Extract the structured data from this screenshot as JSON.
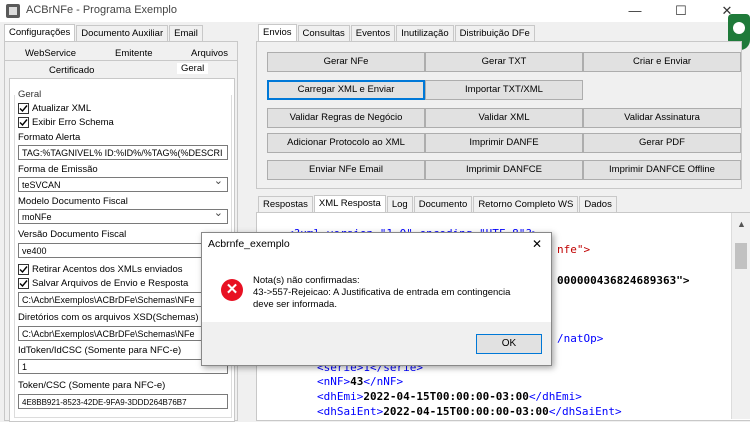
{
  "window": {
    "title": "ACBrNFe - Programa Exemplo",
    "minimize": "—",
    "maximize": "☐",
    "close": "✕"
  },
  "left": {
    "tabs": [
      "Configurações",
      "Documento Auxiliar",
      "Email"
    ],
    "subtabs_row1": [
      "WebService",
      "Emitente",
      "Arquivos"
    ],
    "subtabs_row2": [
      "Certificado",
      "Geral"
    ],
    "group_label": "Geral",
    "check_atualizar": "Atualizar XML",
    "check_exibir": "Exibir Erro Schema",
    "formato_alerta_label": "Formato Alerta",
    "formato_alerta_value": "TAG:%TAGNIVEL% ID:%ID%/%TAG%(%DESCRI",
    "forma_emissao_label": "Forma de Emissão",
    "forma_emissao_value": "teSVCAN",
    "modelo_label": "Modelo Documento Fiscal",
    "modelo_value": "moNFe",
    "versao_label": "Versão Documento Fiscal",
    "versao_value": "ve400",
    "check_retirar": "Retirar Acentos dos XMLs enviados",
    "check_salvar": "Salvar Arquivos de Envio e Resposta",
    "path1": "C:\\Acbr\\Exemplos\\ACBrDFe\\Schemas\\NFe",
    "xsd_label": "Diretórios com os arquivos XSD(Schemas)",
    "path2": "C:\\Acbr\\Exemplos\\ACBrDFe\\Schemas\\NFe",
    "idtoken_label": "IdToken/IdCSC (Somente para NFC-e)",
    "idtoken_value": "1",
    "token_label": "Token/CSC (Somente para NFC-e)",
    "token_value": "4E8BB921-8523-42DE-9FA9-3DDD264B76B7"
  },
  "right": {
    "tabs": [
      "Envios",
      "Consultas",
      "Eventos",
      "Inutilização",
      "Distribuição DFe"
    ],
    "buttons": [
      [
        "Gerar NFe",
        "Gerar TXT",
        "Criar e Enviar"
      ],
      [
        "Carregar XML e Enviar",
        "Importar TXT/XML",
        ""
      ],
      [
        "Validar Regras de Negócio",
        "Validar XML",
        "Validar Assinatura"
      ],
      [
        "Adicionar Protocolo ao XML",
        "Imprimir DANFE",
        "Gerar PDF"
      ],
      [
        "Enviar NFe Email",
        "Imprimir DANFCE",
        "Imprimir DANFCE Offline"
      ]
    ],
    "result_tabs": [
      "Respostas",
      "XML Resposta",
      "Log",
      "Documento",
      "Retorno Completo WS",
      "Dados"
    ],
    "xml": {
      "l1": "<?xml version=\"1.0\" encoding=\"UTF-8\"?>",
      "l2_frag": "nfe\">",
      "l3_frag": "000000436824689363\">",
      "l4_frag": "/natOp>",
      "serie": "<serie>1</serie>",
      "nnf_open": "<nNF>",
      "nnf_val": "43",
      "nnf_close": "</nNF>",
      "dhemi_open": "<dhEmi>",
      "dhemi_val": "2022-04-15T00:00:00-03:00",
      "dhemi_close": "</dhEmi>",
      "dhsai_open": "<dhSaiEnt>",
      "dhsai_val": "2022-04-15T00:00:00-03:00",
      "dhsai_close": "</dhSaiEnt>"
    }
  },
  "dialog": {
    "title": "Acbrnfe_exemplo",
    "close": "✕",
    "line1": "Nota(s) não confirmadas:",
    "line2": "43->557-Rejeicao: A Justificativa de entrada em contingencia",
    "line3": "deve ser informada.",
    "ok": "OK"
  }
}
